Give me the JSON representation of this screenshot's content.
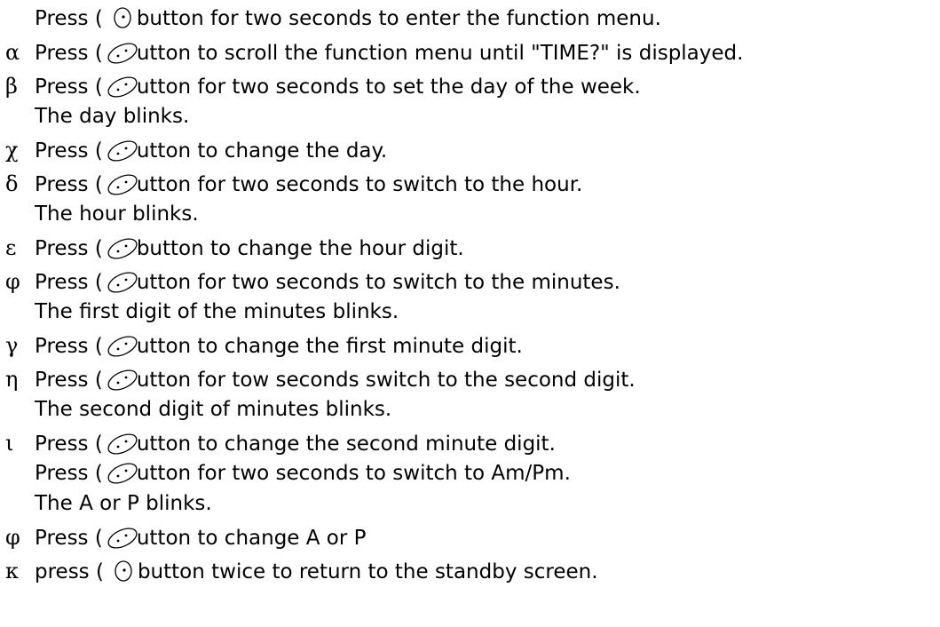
{
  "lines": [
    {
      "marker": "",
      "press": "Press (",
      "rest": "button for two seconds to enter the function menu.",
      "icon": "round-button-icon"
    },
    {
      "marker": "α",
      "press": "Press (",
      "rest": "utton to scroll the function menu until \"TIME?\" is displayed.",
      "icon": "oval-button-icon"
    },
    {
      "marker": "β",
      "press": "Press (",
      "rest": "utton for two seconds to set the day of the week.",
      "icon": "oval-button-icon"
    },
    {
      "text": "The day blinks."
    },
    {
      "marker": "χ",
      "press": "Press (",
      "rest": "utton to change the day.",
      "icon": "oval-button-icon"
    },
    {
      "marker": "δ",
      "press": "Press (",
      "rest": "utton for two seconds to switch to the hour.",
      "icon": "oval-button-icon"
    },
    {
      "text": "The hour blinks."
    },
    {
      "marker": "ε",
      "press": "Press (",
      "rest": "button to change the hour digit.",
      "icon": "oval-button-icon"
    },
    {
      "marker": "φ",
      "press": "Press (",
      "rest": "utton for two seconds to switch to the minutes.",
      "icon": "oval-button-icon"
    },
    {
      "text": "The first digit of the minutes blinks."
    },
    {
      "marker": "γ",
      "press": "Press (",
      "rest": "utton to change the first minute digit.",
      "icon": "oval-button-icon"
    },
    {
      "marker": "η",
      "press": "Press (",
      "rest": "utton for tow seconds switch to the second digit.",
      "icon": "oval-button-icon"
    },
    {
      "text": "The second digit of minutes blinks."
    },
    {
      "marker": "ι",
      "press": "Press (",
      "rest": "utton to change the second minute digit.",
      "icon": "oval-button-icon"
    },
    {
      "marker": "",
      "press": "Press (",
      "rest": "utton for two seconds to switch to Am/Pm.",
      "icon": "oval-button-icon"
    },
    {
      "text": "The A or P blinks."
    },
    {
      "marker": "φ",
      "press": "Press (",
      "rest": "utton to change A or P",
      "icon": "oval-button-icon"
    },
    {
      "marker": "κ",
      "press": "press (",
      "rest": "button twice to return to the standby screen.",
      "icon": "round-button-icon"
    }
  ]
}
